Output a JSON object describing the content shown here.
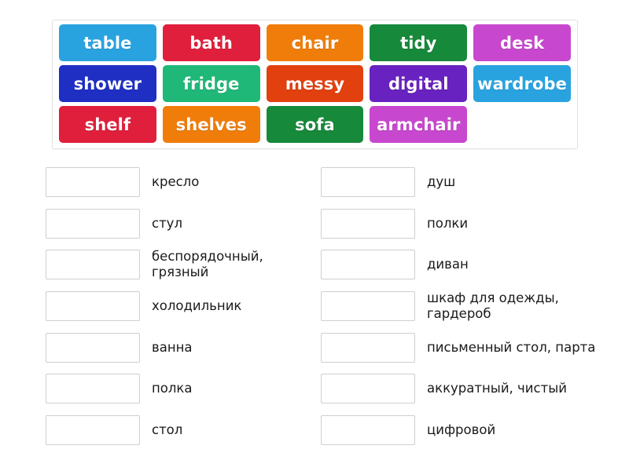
{
  "tiles": {
    "row1": [
      {
        "label": "table",
        "color": "#29a3e0"
      },
      {
        "label": "bath",
        "color": "#e01f3d"
      },
      {
        "label": "chair",
        "color": "#f07d0a"
      },
      {
        "label": "tidy",
        "color": "#17893a"
      },
      {
        "label": "desk",
        "color": "#c748ce"
      }
    ],
    "row2": [
      {
        "label": "shower",
        "color": "#1f2fc4"
      },
      {
        "label": "fridge",
        "color": "#1fb878"
      },
      {
        "label": "messy",
        "color": "#e2400f"
      },
      {
        "label": "digital",
        "color": "#6822bf"
      },
      {
        "label": "wardrobe",
        "color": "#29a3e0"
      }
    ],
    "row3": [
      {
        "label": "shelf",
        "color": "#e01f3d"
      },
      {
        "label": "shelves",
        "color": "#f07d0a"
      },
      {
        "label": "sofa",
        "color": "#17893a"
      },
      {
        "label": "armchair",
        "color": "#c748ce"
      }
    ]
  },
  "answers": {
    "left": [
      {
        "label": "кресло"
      },
      {
        "label": "стул"
      },
      {
        "label": "беспорядочный, грязный"
      },
      {
        "label": "холодильник"
      },
      {
        "label": "ванна"
      },
      {
        "label": "полка"
      },
      {
        "label": "стол"
      }
    ],
    "right": [
      {
        "label": "душ"
      },
      {
        "label": "полки"
      },
      {
        "label": "диван"
      },
      {
        "label": "шкаф для одежды, гардероб"
      },
      {
        "label": "письменный стол, парта"
      },
      {
        "label": "аккуратный, чистый"
      },
      {
        "label": "цифровой"
      }
    ]
  }
}
